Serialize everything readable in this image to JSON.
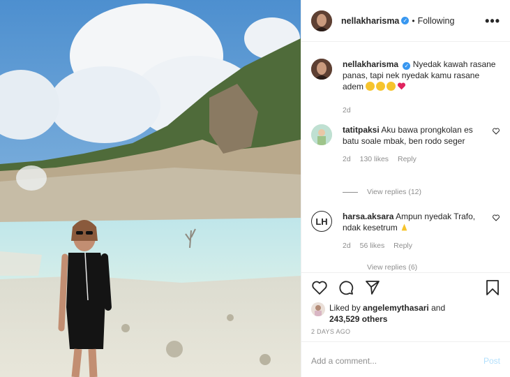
{
  "header": {
    "username": "nellakharisma",
    "separator": "•",
    "follow_label": "Following",
    "more_label": "•••"
  },
  "caption": {
    "username": "nellakharisma",
    "text": "Nyedak kawah rasane panas, tapi nek nyedak kamu rasane adem",
    "time": "2d"
  },
  "comments": [
    {
      "username": "tatitpaksi",
      "text": "Aku bawa prongkolan es batu soale mbak, ben rodo seger",
      "time": "2d",
      "likes": "130 likes",
      "reply": "Reply",
      "view_replies": "View replies (12)"
    },
    {
      "username": "harsa.aksara",
      "text": "Ampun nyedak Trafo, ndak kesetrum",
      "time": "2d",
      "likes": "56 likes",
      "reply": "Reply",
      "view_replies": "View replies (6)"
    }
  ],
  "likes": {
    "prefix": "Liked by",
    "by_user": "angelemythasari",
    "and": "and",
    "others": "243,529 others"
  },
  "timestamp": "2 DAYS AGO",
  "add_comment": {
    "placeholder": "Add a comment...",
    "post_label": "Post"
  },
  "icons": [
    "heart-icon",
    "comment-icon",
    "share-icon",
    "bookmark-icon"
  ]
}
